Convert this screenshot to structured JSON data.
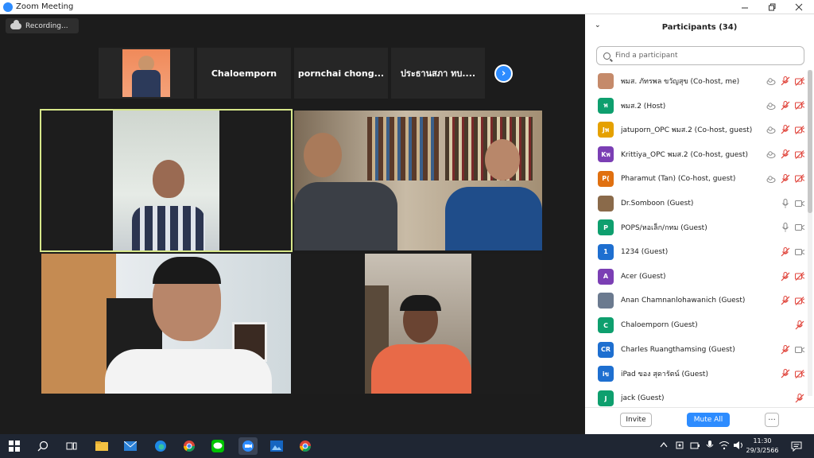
{
  "window": {
    "title": "Zoom Meeting"
  },
  "recording": {
    "label": "Recording..."
  },
  "thumbnails": [
    {
      "name": ""
    },
    {
      "name": "Chaloemporn"
    },
    {
      "name": "pornchai  chong..."
    },
    {
      "name": "ประธานสภา  ทบ...."
    }
  ],
  "panel": {
    "title": "Participants (34)",
    "search_placeholder": "Find a participant",
    "invite_label": "Invite",
    "mute_all_label": "Mute All",
    "more_label": "···",
    "participants": [
      {
        "initials": "",
        "color": "#c58a6a",
        "name": "พมส. ภัทรพล ขวัญสุข (Co-host, me)",
        "icons": [
          "cloud",
          "mic-off",
          "video-off"
        ]
      },
      {
        "initials": "พ",
        "color": "#0e9f6e",
        "name": "พมส.2 (Host)",
        "icons": [
          "cloud",
          "mic-off",
          "video-off"
        ]
      },
      {
        "initials": "Jพ",
        "color": "#e5a100",
        "name": "jatuporn_OPC พมส.2 (Co-host, guest)",
        "icons": [
          "cloud",
          "mic-off",
          "video-off"
        ]
      },
      {
        "initials": "Kพ",
        "color": "#7b3fb4",
        "name": "Krittiya_OPC พมส.2 (Co-host, guest)",
        "icons": [
          "cloud",
          "mic-off",
          "video-off"
        ]
      },
      {
        "initials": "P(",
        "color": "#e07010",
        "name": "Pharamut (Tan) (Co-host, guest)",
        "icons": [
          "cloud",
          "mic-off",
          "video-off"
        ]
      },
      {
        "initials": "",
        "color": "#8a6a4a",
        "name": "Dr.Somboon (Guest)",
        "icons": [
          "mic",
          "video"
        ]
      },
      {
        "initials": "P",
        "color": "#0e9f6e",
        "name": "POPS/หอเล็ก/กทม (Guest)",
        "icons": [
          "mic",
          "video"
        ]
      },
      {
        "initials": "1",
        "color": "#1e6fd0",
        "name": "1234 (Guest)",
        "icons": [
          "mic-off",
          "video"
        ]
      },
      {
        "initials": "A",
        "color": "#7b3fb4",
        "name": "Acer (Guest)",
        "icons": [
          "mic-off",
          "video-off"
        ]
      },
      {
        "initials": "",
        "color": "#6b7a8f",
        "name": "Anan Chamnanlohawanich (Guest)",
        "icons": [
          "mic-off",
          "video-off"
        ]
      },
      {
        "initials": "C",
        "color": "#0e9f6e",
        "name": "Chaloemporn (Guest)",
        "icons": [
          "mic-off"
        ]
      },
      {
        "initials": "CR",
        "color": "#1e6fd0",
        "name": "Charles Ruangthamsing (Guest)",
        "icons": [
          "mic-off",
          "video"
        ]
      },
      {
        "initials": "iข",
        "color": "#1e6fd0",
        "name": "iPad ของ สุดารัตน์ (Guest)",
        "icons": [
          "mic-off",
          "video-off"
        ]
      },
      {
        "initials": "J",
        "color": "#0e9f6e",
        "name": "jack (Guest)",
        "icons": [
          "mic-off"
        ]
      }
    ]
  },
  "taskbar": {
    "time": "11:30",
    "date": "29/3/2566"
  },
  "colors": {
    "accent": "#2d8cff",
    "mute_red": "#e0453c",
    "active_tile": "#d7e78a"
  }
}
